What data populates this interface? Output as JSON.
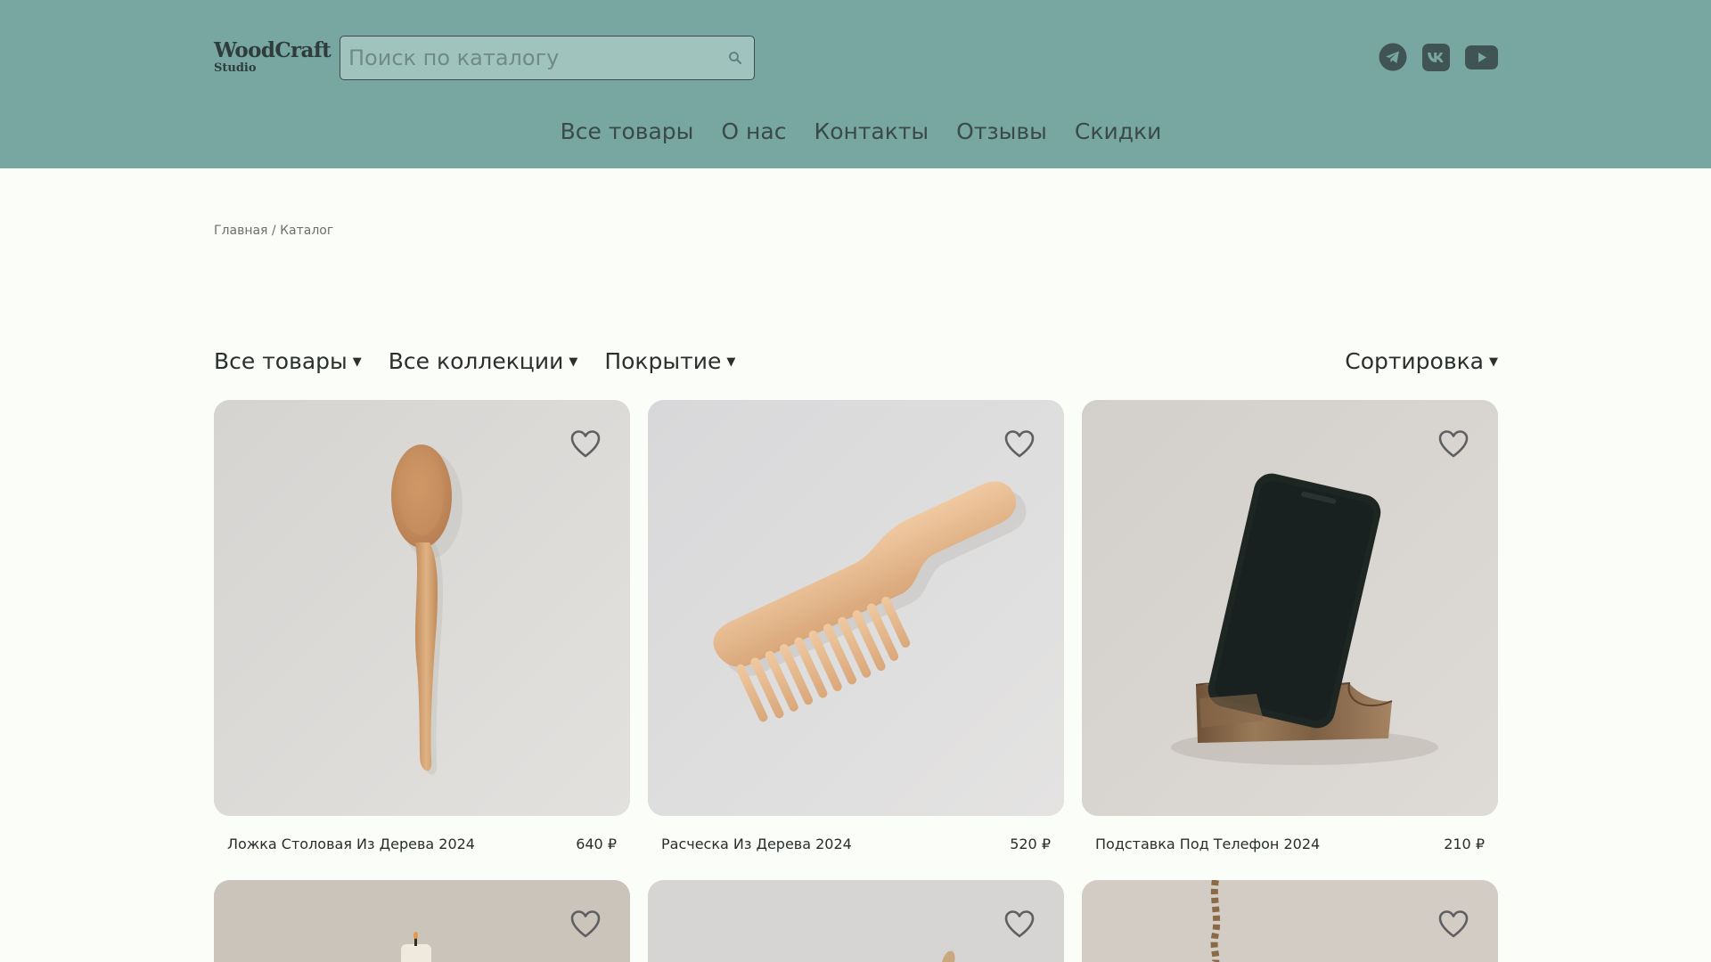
{
  "brand": {
    "name": "WoodCraft",
    "tagline": "Studio"
  },
  "search": {
    "placeholder": "Поиск по каталогу"
  },
  "socials": [
    "telegram-icon",
    "vk-icon",
    "youtube-icon"
  ],
  "nav": [
    "Все товары",
    "О нас",
    "Контакты",
    "Отзывы",
    "Скидки"
  ],
  "breadcrumb": "Главная / Каталог",
  "filters": [
    "Все товары",
    "Все коллекции",
    "Покрытие"
  ],
  "sort_label": "Сортировка",
  "products": [
    {
      "title": "Ложка Столовая Из Дерева 2024",
      "price": "640 ₽"
    },
    {
      "title": "Расческа Из Дерева 2024",
      "price": "520 ₽"
    },
    {
      "title": "Подставка Под Телефон 2024",
      "price": "210 ₽"
    }
  ],
  "colors": {
    "header": "#78a6a0",
    "background": "#fbfdf9",
    "text": "#2a2f2e"
  }
}
